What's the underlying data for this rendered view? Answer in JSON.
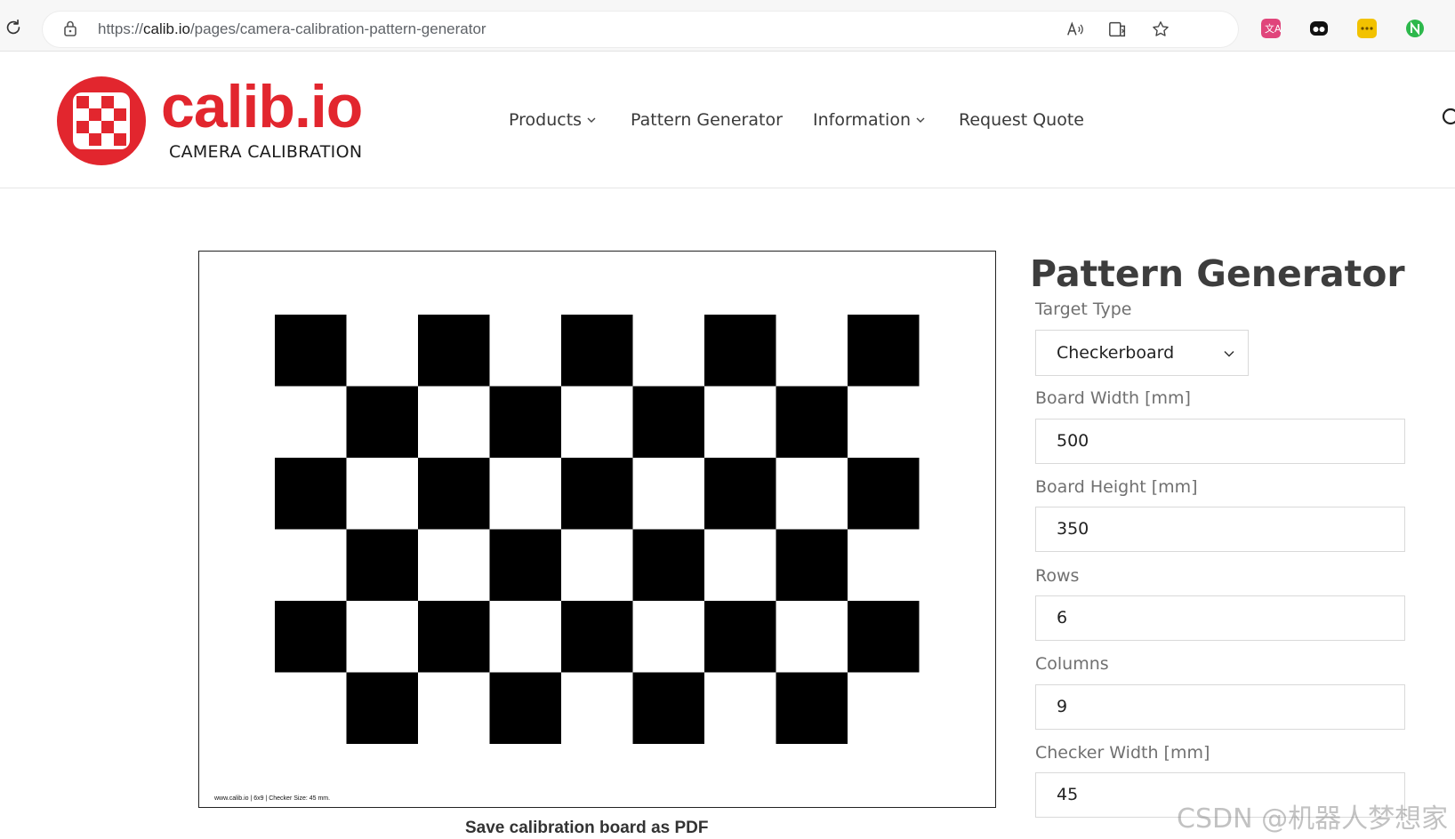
{
  "browser": {
    "url_prefix": "https://",
    "url_host": "calib.io",
    "url_path": "/pages/camera-calibration-pattern-generator"
  },
  "header": {
    "logo_text": "calib.io",
    "logo_tagline": "CAMERA CALIBRATION",
    "nav": [
      {
        "label": "Products",
        "has_dropdown": true
      },
      {
        "label": "Pattern Generator",
        "has_dropdown": false
      },
      {
        "label": "Information",
        "has_dropdown": true
      },
      {
        "label": "Request Quote",
        "has_dropdown": false
      }
    ]
  },
  "preview": {
    "rows": 6,
    "columns": 9,
    "footer_note": "www.calib.io | 6x9 | Checker Size: 45 mm.",
    "save_label": "Save calibration board as PDF"
  },
  "form": {
    "title": "Pattern Generator",
    "target_type": {
      "label": "Target Type",
      "value": "Checkerboard"
    },
    "board_width": {
      "label": "Board Width [mm]",
      "value": "500"
    },
    "board_height": {
      "label": "Board Height [mm]",
      "value": "350"
    },
    "rows": {
      "label": "Rows",
      "value": "6"
    },
    "columns": {
      "label": "Columns",
      "value": "9"
    },
    "checker_width": {
      "label": "Checker Width [mm]",
      "value": "45"
    }
  },
  "watermark": "CSDN @机器人梦想家",
  "colors": {
    "brand_red": "#e2262e",
    "checker_dark": "#000000"
  }
}
